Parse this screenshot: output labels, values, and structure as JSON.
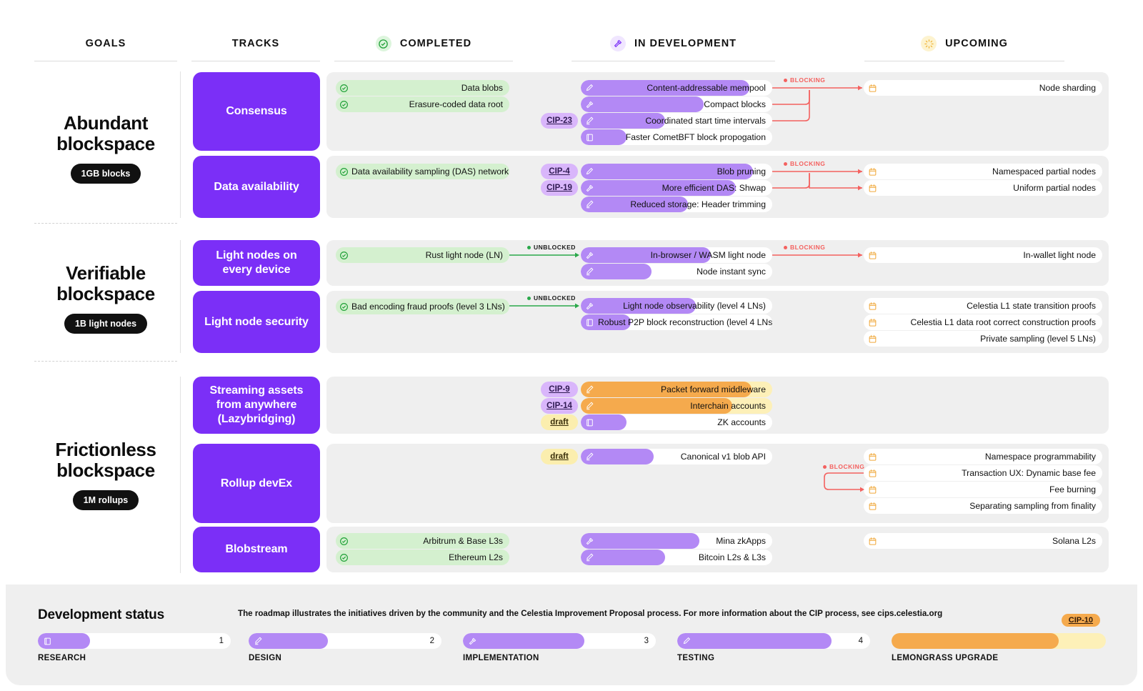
{
  "headers": [
    {
      "id": "goals",
      "label": "GOALS",
      "icon": null
    },
    {
      "id": "tracks",
      "label": "TRACKS",
      "icon": null
    },
    {
      "id": "completed",
      "label": "COMPLETED",
      "icon": "check-circle-icon"
    },
    {
      "id": "indev",
      "label": "IN DEVELOPMENT",
      "icon": "hammer-icon"
    },
    {
      "id": "upcoming",
      "label": "UPCOMING",
      "icon": "sun-icon"
    }
  ],
  "goals": [
    {
      "title": "Abundant blockspace",
      "line1": "Abundant",
      "line2": "blockspace",
      "pill": "1GB blocks"
    },
    {
      "title": "Verifiable blockspace",
      "line1": "Verifiable",
      "line2": "blockspace",
      "pill": "1B light nodes"
    },
    {
      "title": "Frictionless blockspace",
      "line1": "Frictionless",
      "line2": "blockspace",
      "pill": "1M rollups"
    }
  ],
  "tracks": [
    {
      "name": "Consensus"
    },
    {
      "name": "Data availability"
    },
    {
      "name": "Light nodes on every device"
    },
    {
      "name": "Light node security"
    },
    {
      "name": "Streaming assets from anywhere (Lazybridging)"
    },
    {
      "name": "Rollup devEx"
    },
    {
      "name": "Blobstream"
    }
  ],
  "items": {
    "completed": [
      {
        "label": "Data blobs"
      },
      {
        "label": "Erasure-coded data root"
      },
      {
        "label": "Data availability sampling (DAS) network"
      },
      {
        "label": "Rust light node (LN)"
      },
      {
        "label": "Bad encoding fraud proofs (level 3 LNs)"
      },
      {
        "label": "Arbitrum & Base L3s"
      },
      {
        "label": "Ethereum L2s"
      }
    ],
    "in_development": [
      {
        "label": "Content-addressable mempool",
        "stage": "testing",
        "progress": 88,
        "cip": null,
        "lemongrass": false
      },
      {
        "label": "Compact blocks",
        "stage": "implementation",
        "progress": 64,
        "cip": null,
        "lemongrass": false
      },
      {
        "label": "Coordinated start time intervals",
        "stage": "design",
        "progress": 44,
        "cip": "CIP-23",
        "lemongrass": false
      },
      {
        "label": "Faster CometBFT block propogation",
        "stage": "research",
        "progress": 24,
        "cip": null,
        "lemongrass": false
      },
      {
        "label": "Blob pruning",
        "stage": "testing",
        "progress": 90,
        "cip": "CIP-4",
        "lemongrass": false
      },
      {
        "label": "More efficient DAS: Shwap",
        "stage": "implementation",
        "progress": 81,
        "cip": "CIP-19",
        "lemongrass": false
      },
      {
        "label": "Reduced storage: Header trimming",
        "stage": "design",
        "progress": 56,
        "cip": null,
        "lemongrass": false
      },
      {
        "label": "In-browser / WASM light node",
        "stage": "implementation",
        "progress": 68,
        "cip": null,
        "lemongrass": false
      },
      {
        "label": "Node instant sync",
        "stage": "design",
        "progress": 37,
        "cip": null,
        "lemongrass": false
      },
      {
        "label": "Light node observability (level 4 LNs)",
        "stage": "implementation",
        "progress": 60,
        "cip": null,
        "lemongrass": false
      },
      {
        "label": "Robust P2P block reconstruction (level 4 LNs)",
        "stage": "research",
        "progress": 26,
        "cip": null,
        "lemongrass": false
      },
      {
        "label": "Packet forward middleware",
        "stage": "design",
        "progress": 89,
        "cip": "CIP-9",
        "lemongrass": true
      },
      {
        "label": "Interchain accounts",
        "stage": "design",
        "progress": 79,
        "cip": "CIP-14",
        "lemongrass": true
      },
      {
        "label": "ZK accounts",
        "stage": "research",
        "progress": 24,
        "cip": "draft",
        "lemongrass": false
      },
      {
        "label": "Canonical v1 blob API",
        "stage": "design",
        "progress": 38,
        "cip": "draft",
        "lemongrass": false
      },
      {
        "label": "Mina zkApps",
        "stage": "implementation",
        "progress": 62,
        "cip": null,
        "lemongrass": false
      },
      {
        "label": "Bitcoin L2s & L3s",
        "stage": "design",
        "progress": 44,
        "cip": null,
        "lemongrass": false
      }
    ],
    "upcoming": [
      {
        "label": "Node sharding"
      },
      {
        "label": "Namespaced partial nodes"
      },
      {
        "label": "Uniform partial nodes"
      },
      {
        "label": "In-wallet light node"
      },
      {
        "label": "Celestia L1 state transition proofs"
      },
      {
        "label": "Celestia L1 data root correct construction proofs"
      },
      {
        "label": "Private sampling (level 5 LNs)"
      },
      {
        "label": "Namespace programmability"
      },
      {
        "label": "Transaction UX: Dynamic base fee"
      },
      {
        "label": "Fee burning"
      },
      {
        "label": "Separating sampling from finality"
      },
      {
        "label": "Solana L2s"
      }
    ]
  },
  "connectors": {
    "blocking_label": "BLOCKING",
    "unblocked_label": "UNBLOCKED"
  },
  "footer": {
    "title": "Development status",
    "description": "The roadmap illustrates the initiatives driven by the community and the Celestia Improvement Proposal process. For more information about the CIP process, see cips.celestia.org",
    "stages": [
      {
        "caption": "RESEARCH",
        "number": "1",
        "icon": "book-icon",
        "progress": 27
      },
      {
        "caption": "DESIGN",
        "number": "2",
        "icon": "pencil-icon",
        "progress": 41
      },
      {
        "caption": "IMPLEMENTATION",
        "number": "3",
        "icon": "hammer-icon",
        "progress": 63
      },
      {
        "caption": "TESTING",
        "number": "4",
        "icon": "pen-icon",
        "progress": 80
      }
    ],
    "lemongrass": {
      "caption": "LEMONGRASS UPGRADE",
      "badge": "CIP-10",
      "progress": 78
    }
  },
  "colors": {
    "purple": "#7b2ff7",
    "progress_purple": "#b389f5",
    "orange": "#f5aa4d",
    "lemon_track": "#fdf0b8",
    "green": "#d4f0cf",
    "blocking_red": "#f4615f",
    "unblocked_green": "#2aa84a",
    "band_gray": "#efefef"
  }
}
